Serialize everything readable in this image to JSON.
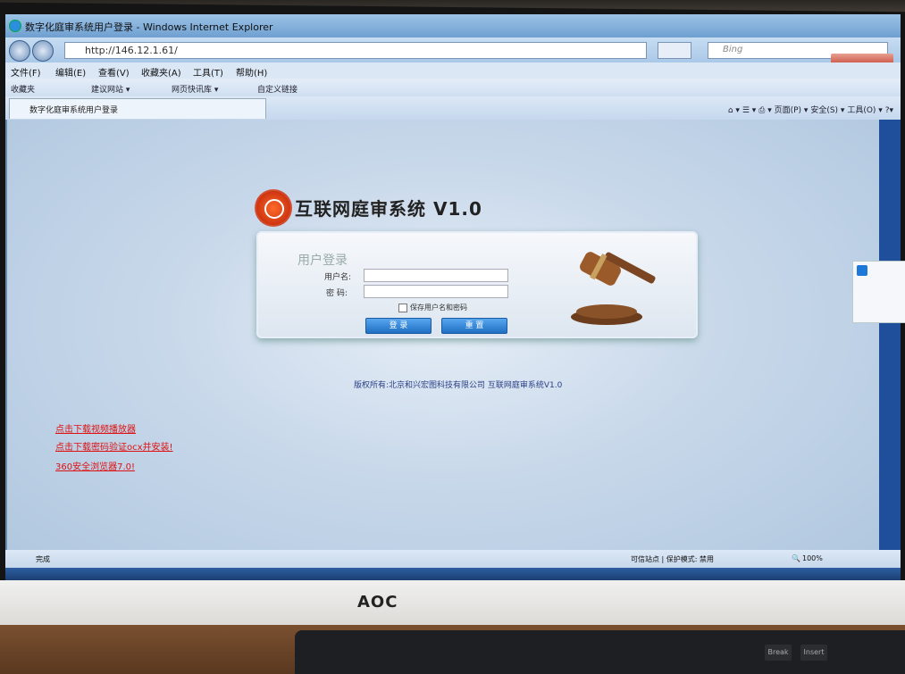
{
  "browser": {
    "window_title": "数字化庭审系统用户登录 - Windows Internet Explorer",
    "url": "http://146.12.1.61/",
    "search_placeholder": "Bing",
    "menu": [
      "文件(F)",
      "编辑(E)",
      "查看(V)",
      "收藏夹(A)",
      "工具(T)",
      "帮助(H)"
    ],
    "favorites": [
      "收藏夹",
      "建议网站 ▾",
      "网页快讯库 ▾",
      "自定义链接"
    ],
    "tab_label": "数字化庭审系统用户登录",
    "toolbar": [
      "页面(P) ▾",
      "安全(S) ▾",
      "工具(O) ▾"
    ],
    "status_left": "完成",
    "status_zone": "可信站点 | 保护模式: 禁用",
    "zoom": "100%"
  },
  "page": {
    "app_title": "互联网庭审系统 V1.0",
    "login_heading": "用户登录",
    "username_label": "用户名:",
    "password_label": "密  码:",
    "remember_label": "保存用户名和密码",
    "login_button": "登 录",
    "reset_button": "重 置",
    "copyright": "版权所有:北京和兴宏图科技有限公司 互联网庭审系统V1.0",
    "links": [
      "点击下载视频播放器",
      "点击下载密码验证ocx并安装!",
      "360安全浏览器7.0!"
    ]
  },
  "monitor": {
    "brand": "AOC"
  },
  "keyboard": {
    "keys": [
      "Break",
      "Insert"
    ]
  }
}
